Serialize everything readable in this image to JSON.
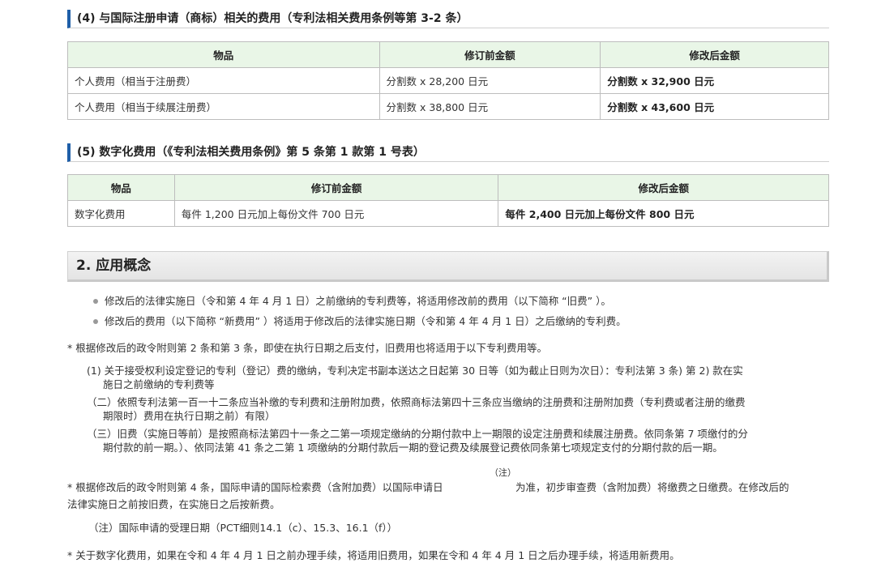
{
  "section4": {
    "title": "(4) 与国际注册申请（商标）相关的费用（专利法相关费用条例等第 3-2 条）",
    "headers": [
      "物品",
      "修订前金额",
      "修改后金额"
    ],
    "rows": [
      [
        "个人费用（相当于注册费）",
        "分割数 x 28,200 日元",
        "分割数 x 32,900 日元"
      ],
      [
        "个人费用（相当于续展注册费）",
        "分割数 x 38,800 日元",
        "分割数 x 43,600 日元"
      ]
    ]
  },
  "section5": {
    "title": "(5) 数字化费用（《专利法相关费用条例》第 5 条第 1 款第 1 号表）",
    "headers": [
      "物品",
      "修订前金额",
      "修改后金额"
    ],
    "rows": [
      [
        "数字化费用",
        "每件 1,200 日元加上每份文件 700 日元",
        "每件 2,400 日元加上每份文件 800 日元"
      ]
    ]
  },
  "concept": {
    "heading": "2. 应用概念",
    "bullets": [
      "修改后的法律实施日（令和第 4 年 4 月 1 日）之前缴纳的专利费等，将适用修改前的费用（以下简称 “旧费” ）。",
      "修改后的费用（以下简称 “新费用” ）将适用于修改后的法律实施日期（令和第 4 年 4 月 1 日）之后缴纳的专利费。"
    ],
    "note1": "* 根据修改后的政令附则第 2 条和第 3 条，即使在执行日期之后支付，旧费用也将适用于以下专利费用等。",
    "items": [
      {
        "line1": "(1) 关于接受权利设定登记的专利（登记）费的缴纳，专利决定书副本送达之日起第 30 日等（如为截止日则为次日）：专利法第 3 条) 第 2) 款在实",
        "line2": "施日之前缴纳的专利费等"
      },
      {
        "line1": "（二）依照专利法第一百一十二条应当补缴的专利费和注册附加费，依照商标法第四十三条应当缴纳的注册费和注册附加费（专利费或者注册的缴费",
        "line2": "期限时）费用在执行日期之前）有限）"
      },
      {
        "line1": "（三）旧费（实施日等前）是按照商标法第四十一条之二第一项规定缴纳的分期付款中上一期限的设定注册费和续展注册费。依同条第 7 项缴付的分",
        "line2": "期付款的前一期。）、依同法第 41 条之二第 1 项缴纳的分期付款后一期的登记费及续展登记费依同条第七项规定支付的分期付款的后一期。"
      }
    ],
    "note_sup": "（注）",
    "note2_a": "* 根据修改后的政令附则第 4 条，国际申请的国际检索费（含附加费）以国际申请日",
    "note2_b": "为准，初步审查费（含附加费）将缴费之日缴费。在修改后的",
    "note2_c": "法律实施日之前按旧费，在实施日之后按新费。",
    "note_detail": "（注）国际申请的受理日期（PCT细则14.1（c）、15.3、16.1（f））",
    "note3": "* 关于数字化费用，如果在令和 4 年 4 月 1 日之前办理手续，将适用旧费用，如果在令和 4 年 4 月 1 日之后办理手续，将适用新费用。"
  }
}
